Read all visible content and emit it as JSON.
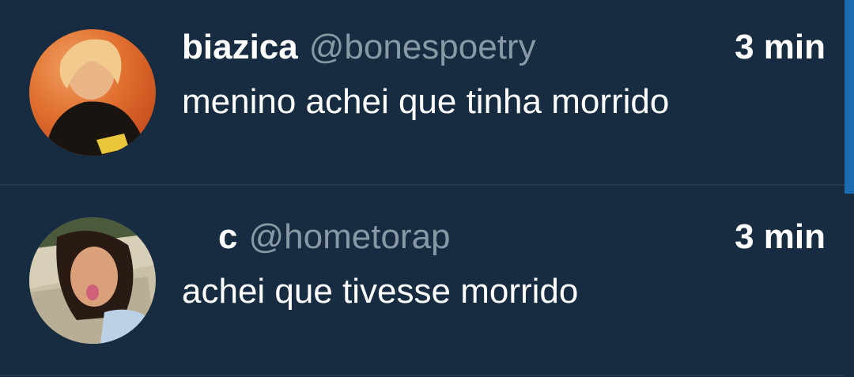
{
  "tweets": [
    {
      "name": "biazica",
      "handle": "@bonespoetry",
      "time": "3 min",
      "text": "menino achei que tinha morrido"
    },
    {
      "name": "c",
      "handle": "@hometorap",
      "time": "3 min",
      "text": "achei que tivesse morrido"
    }
  ],
  "colors": {
    "background": "#172c41",
    "divider": "#26394c",
    "handle": "#8899a6",
    "accent": "#1b6bb0"
  }
}
